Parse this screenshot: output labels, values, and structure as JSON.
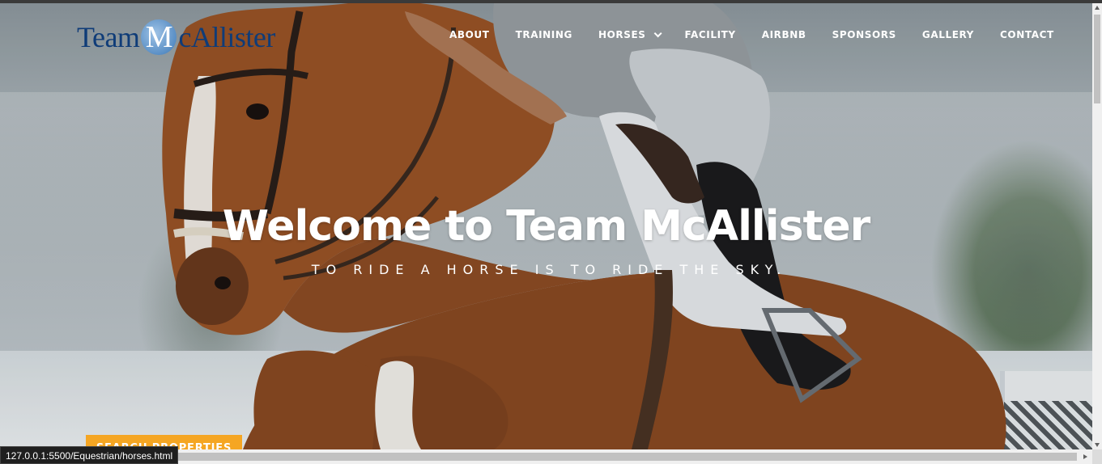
{
  "logo": {
    "pre": "Team ",
    "mark": "M",
    "post": "cAllister",
    "brand_color": "#0f3c78"
  },
  "nav": {
    "about": "ABOUT",
    "training": "TRAINING",
    "horses": "HORSES",
    "facility": "FACILITY",
    "airbnb": "AIRBNB",
    "sponsors": "SPONSORS",
    "gallery": "GALLERY",
    "contact": "CONTACT"
  },
  "hero": {
    "title": "Welcome to Team McAllister",
    "subtitle": "TO RIDE A HORSE IS TO RIDE THE SKY."
  },
  "cta": {
    "label": "SEARCH PROPERTIES",
    "color": "#f5a623"
  },
  "status_bar": {
    "url": "127.0.0.1:5500/Equestrian/horses.html"
  }
}
